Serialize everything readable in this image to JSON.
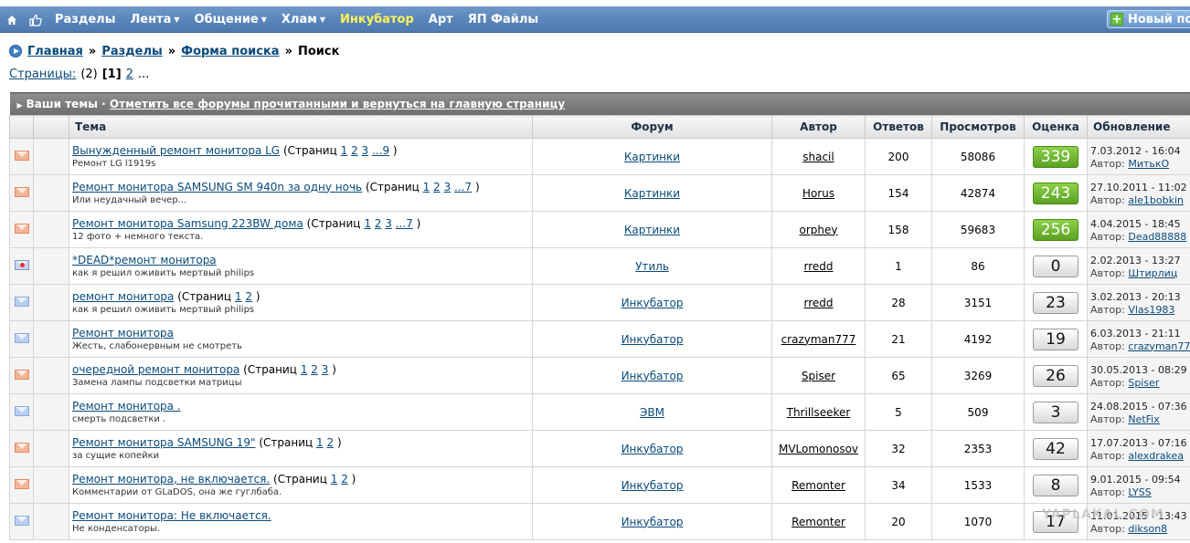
{
  "nav": {
    "items": [
      {
        "label": "Разделы",
        "caret": false,
        "accent": false
      },
      {
        "label": "Лента",
        "caret": true,
        "accent": false
      },
      {
        "label": "Общение",
        "caret": true,
        "accent": false
      },
      {
        "label": "Хлам",
        "caret": true,
        "accent": false
      },
      {
        "label": "Инкубатор",
        "caret": false,
        "accent": true
      },
      {
        "label": "Арт",
        "caret": false,
        "accent": false
      },
      {
        "label": "ЯП Файлы",
        "caret": false,
        "accent": false
      }
    ],
    "new_post_label": "Новый по",
    "icons": [
      "home-icon",
      "thumbs-up-icon"
    ]
  },
  "breadcrumb": {
    "items": [
      "Главная",
      "Разделы",
      "Форма поиска"
    ],
    "current": "Поиск",
    "separator": "»"
  },
  "pages": {
    "label": "Страницы:",
    "count": "(2)",
    "current": "[1]",
    "next": "2",
    "ellipsis": "..."
  },
  "banner": {
    "label": "Ваши темы",
    "dot": "·",
    "link": "Отметить все форумы прочитанными и вернуться на главную страницу"
  },
  "columns": [
    "Тема",
    "Форум",
    "Автор",
    "Ответов",
    "Просмотров",
    "Оценка",
    "Обновление"
  ],
  "colors": {
    "accent_yellow": "#fff55a",
    "rating_green": "#5aa222",
    "envelope_orange": "#f4b496",
    "envelope_blue": "#b9cff0"
  },
  "topics": [
    {
      "icon": "orange",
      "title": "Вынужденный ремонт монитора LG",
      "pages": [
        "1",
        "2",
        "3",
        "...9"
      ],
      "desc": "Ремонт LG l1919s",
      "forum": "Картинки",
      "author": "shacil",
      "replies": "200",
      "views": "58086",
      "rating": "339",
      "rating_style": "green",
      "updated": "7.03.2012 - 16:04",
      "updated_by": "МитькО"
    },
    {
      "icon": "orange",
      "title": "Ремонт монитора SAMSUNG SM 940n за одну ночь",
      "pages": [
        "1",
        "2",
        "3",
        "...7"
      ],
      "desc": "Или неудачный вечер...",
      "forum": "Картинки",
      "author": "Horus",
      "replies": "154",
      "views": "42874",
      "rating": "243",
      "rating_style": "green",
      "updated": "27.10.2011 - 11:02",
      "updated_by": "ale1bobkin"
    },
    {
      "icon": "orange",
      "title": "Ремонт монитора Samsung 223BW дома",
      "pages": [
        "1",
        "2",
        "3",
        "...7"
      ],
      "desc": "12 фото + немного текста.",
      "forum": "Картинки",
      "author": "orphey",
      "replies": "158",
      "views": "59683",
      "rating": "256",
      "rating_style": "green",
      "updated": "4.04.2015 - 18:45",
      "updated_by": "Dead88888"
    },
    {
      "icon": "dead",
      "title": "*DEAD*ремонт монитора",
      "pages": [],
      "desc": "как я решил оживить мертвый philips",
      "forum": "Утиль",
      "author": "rredd",
      "replies": "1",
      "views": "86",
      "rating": "0",
      "rating_style": "grey",
      "updated": "2.02.2013 - 13:27",
      "updated_by": "Штирлиц"
    },
    {
      "icon": "blue",
      "title": "ремонт монитора",
      "pages": [
        "1",
        "2"
      ],
      "desc": "как я решил оживить мертвый philips",
      "forum": "Инкубатор",
      "author": "rredd",
      "replies": "28",
      "views": "3151",
      "rating": "23",
      "rating_style": "grey",
      "updated": "3.02.2013 - 20:13",
      "updated_by": "Vlas1983"
    },
    {
      "icon": "blue",
      "title": "Ремонт монитора",
      "pages": [],
      "desc": "Жесть, слабонервным не смотреть",
      "forum": "Инкубатор",
      "author": "crazyman777",
      "replies": "21",
      "views": "4192",
      "rating": "19",
      "rating_style": "grey",
      "updated": "6.03.2013 - 21:11",
      "updated_by": "crazyman77"
    },
    {
      "icon": "orange",
      "title": "очередной ремонт монитора",
      "pages": [
        "1",
        "2",
        "3"
      ],
      "desc": "Замена лампы подсветки матрицы",
      "forum": "Инкубатор",
      "author": "Spiser",
      "replies": "65",
      "views": "3269",
      "rating": "26",
      "rating_style": "grey",
      "updated": "30.05.2013 - 08:29",
      "updated_by": "Spiser"
    },
    {
      "icon": "blue",
      "title": "Ремонт монитора .",
      "pages": [],
      "desc": "смерть подсветки .",
      "forum": "ЭВМ",
      "author": "Thrillseeker",
      "replies": "5",
      "views": "509",
      "rating": "3",
      "rating_style": "grey",
      "updated": "24.08.2015 - 07:36",
      "updated_by": "NetFix"
    },
    {
      "icon": "orange",
      "title": "Ремонт монитора SAMSUNG 19\"",
      "pages": [
        "1",
        "2"
      ],
      "desc": "за сущие копейки",
      "forum": "Инкубатор",
      "author": "MVLomonosov",
      "replies": "32",
      "views": "2353",
      "rating": "42",
      "rating_style": "grey",
      "updated": "17.07.2013 - 07:16",
      "updated_by": "alexdrakea"
    },
    {
      "icon": "orange",
      "title": "Ремонт монитора, не включается.",
      "pages": [
        "1",
        "2"
      ],
      "desc": "Комментарии от GLaDOS, она же гуглбаба.",
      "forum": "Инкубатор",
      "author": "Remonter",
      "replies": "34",
      "views": "1533",
      "rating": "8",
      "rating_style": "grey",
      "updated": "9.01.2015 - 09:54",
      "updated_by": "LYSS"
    },
    {
      "icon": "blue",
      "title": "Ремонт монитора: Не включается.",
      "pages": [],
      "desc": "Не конденсаторы.",
      "forum": "Инкубатор",
      "author": "Remonter",
      "replies": "20",
      "views": "1070",
      "rating": "17",
      "rating_style": "grey",
      "updated": "11.01.2015 - 13:43",
      "updated_by": "dikson8"
    }
  ],
  "labels": {
    "pages_prefix": "(Страниц",
    "pages_suffix": ")",
    "author_prefix": "Автор:"
  },
  "watermark": "YAPLAKAL.COM"
}
